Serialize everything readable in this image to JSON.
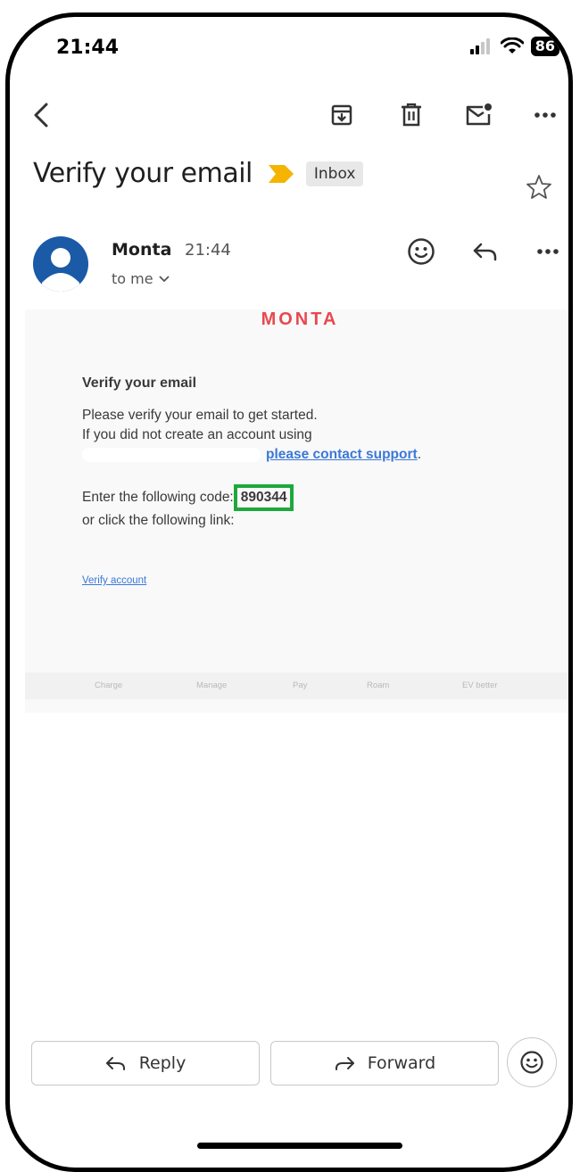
{
  "status_bar": {
    "time": "21:44",
    "battery": "86"
  },
  "toolbar": {
    "back_icon": "chevron-left-icon",
    "archive_icon": "archive-icon",
    "delete_icon": "trash-icon",
    "mark_unread_icon": "mail-unread-icon",
    "more_icon": "more-horizontal-icon"
  },
  "email": {
    "subject": "Verify your email",
    "label": "Inbox",
    "sender_name": "Monta",
    "sent_time": "21:44",
    "recipient": "to me"
  },
  "content": {
    "brand": "MONTA",
    "heading": "Verify your email",
    "line1": "Please verify your email to get started.",
    "line2": "If you did not create an account using",
    "support_link": "please contact support",
    "support_suffix": ".",
    "code_prefix": "Enter the following code:",
    "code": "890344",
    "link_line": "or click the following link:",
    "verify_link": "Verify account",
    "footer": [
      "Charge",
      "Manage",
      "Pay",
      "Roam",
      "EV better"
    ]
  },
  "actions": {
    "reply": "Reply",
    "forward": "Forward"
  },
  "colors": {
    "brand": "#e8484f",
    "link": "#3b78d8",
    "highlight": "#1ea83c",
    "avatar": "#1a5aa6",
    "important_marker": "#f5b400"
  }
}
